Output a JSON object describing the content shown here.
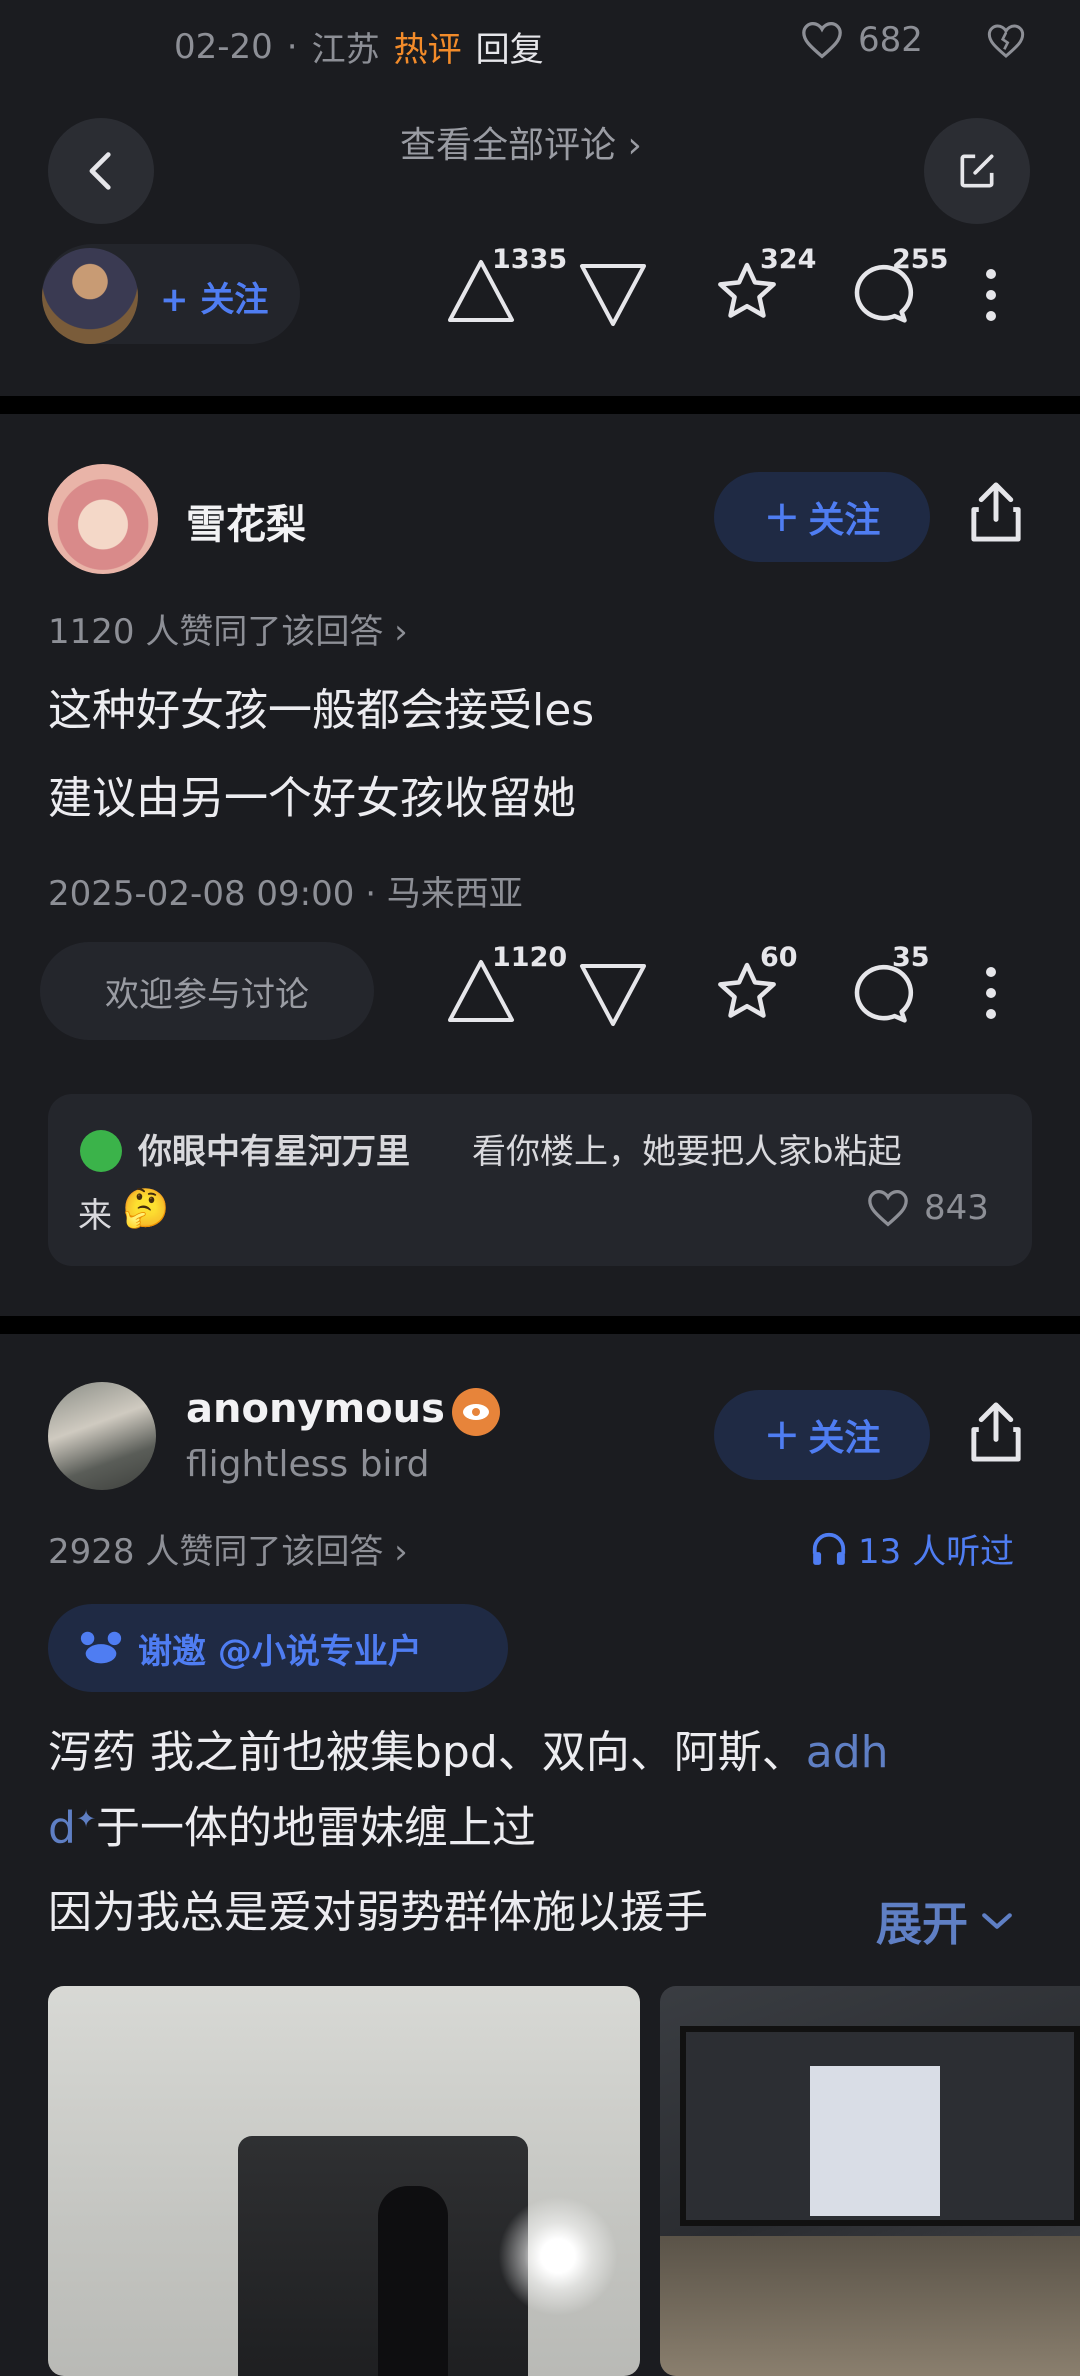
{
  "top": {
    "date": "02-20",
    "dot": "·",
    "location": "江苏",
    "hot": "热评",
    "reply": "回复",
    "like_count": "682",
    "view_all": "查看全部评论 ›",
    "follow_label": "+ 关注",
    "upvotes": "1335",
    "stars": "324",
    "comments": "255"
  },
  "answer1": {
    "author": "雪花梨",
    "follow_label": "关注",
    "agree_text": "1120 人赞同了该回答 ›",
    "lines": [
      "这种好女孩一般都会接受les",
      "建议由另一个好女孩收留她"
    ],
    "date": "2025-02-08 09:00 · 马来西亚",
    "discuss_placeholder": "欢迎参与讨论",
    "upvotes": "1120",
    "stars": "60",
    "comments": "35",
    "top_comment": {
      "user": "你眼中有星河万里",
      "text1": "看你楼上，她要把人家b粘起",
      "text2": "来",
      "emoji": "🤔",
      "likes": "843"
    }
  },
  "answer2": {
    "author": "anonymous",
    "subtitle": "flightless bird",
    "follow_label": "关注",
    "agree_text": "2928 人赞同了该回答 ›",
    "listened": "13 人听过",
    "invite": "谢邀 @小说专业户",
    "line1_a": "泻药 我之前也被集bpd、双向、阿斯、",
    "line1_link": "adh",
    "line2_link": "d",
    "line2_rest": "于一体的地雷妹缠上过",
    "line3": "因为我总是爱对弱势群体施以援手",
    "expand": "展开"
  },
  "colors": {
    "background": "#1b1c20",
    "accent_blue": "#4f7df2",
    "hot_orange": "#f28b2a"
  }
}
